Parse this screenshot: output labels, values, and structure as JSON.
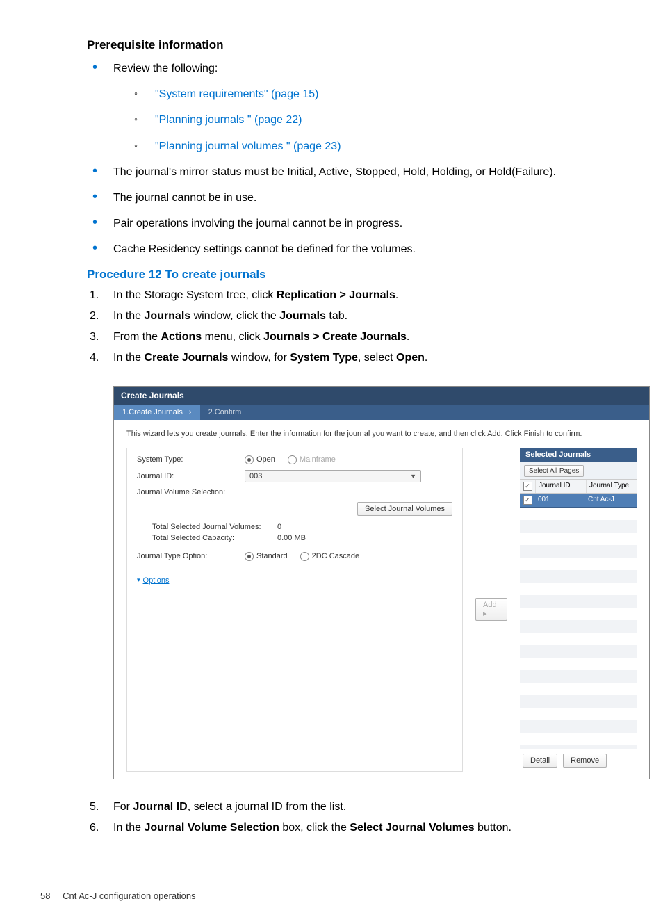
{
  "heading_prereq": "Prerequisite information",
  "bullets": {
    "review": "Review the following:",
    "sub1": "\"System requirements\" (page 15)",
    "sub2": "\"Planning journals \" (page 22)",
    "sub3": "\"Planning journal volumes \" (page 23)",
    "b2": "The journal's mirror status must be Initial, Active, Stopped, Hold, Holding, or Hold(Failure).",
    "b3": "The journal cannot be in use.",
    "b4": "Pair operations involving the journal cannot be in progress.",
    "b5": "Cache Residency settings cannot be defined for the volumes."
  },
  "proc_heading": "Procedure 12 To create journals",
  "steps": {
    "s1a": "In the Storage System tree, click ",
    "s1b": "Replication > Journals",
    "s1c": ".",
    "s2a": "In the ",
    "s2b": "Journals",
    "s2c": " window, click the ",
    "s2d": "Journals",
    "s2e": " tab.",
    "s3a": "From the ",
    "s3b": "Actions",
    "s3c": " menu, click ",
    "s3d": "Journals > Create Journals",
    "s3e": ".",
    "s4a": "In the ",
    "s4b": "Create Journals",
    "s4c": " window, for ",
    "s4d": "System Type",
    "s4e": ", select ",
    "s4f": "Open",
    "s4g": ".",
    "s5a": "For ",
    "s5b": "Journal ID",
    "s5c": ", select a journal ID from the list.",
    "s6a": "In the ",
    "s6b": "Journal Volume Selection",
    "s6c": " box, click the ",
    "s6d": "Select Journal Volumes",
    "s6e": " button."
  },
  "shot": {
    "title": "Create Journals",
    "tab1": "1.Create Journals",
    "tab2": "2.Confirm",
    "instr": "This wizard lets you create journals. Enter the information for the journal you want to create, and then click Add. Click Finish to confirm.",
    "system_type_label": "System Type:",
    "open": "Open",
    "mainframe": "Mainframe",
    "journal_id_label": "Journal ID:",
    "journal_id_value": "003",
    "jvs_label": "Journal Volume Selection:",
    "select_jv_btn": "Select Journal Volumes",
    "total_vols_label": "Total Selected Journal Volumes:",
    "total_vols_value": "0",
    "total_cap_label": "Total Selected Capacity:",
    "total_cap_value": "0.00 MB",
    "jto_label": "Journal Type Option:",
    "standard": "Standard",
    "cascade": "2DC Cascade",
    "options_link": "Options",
    "add_btn": "Add ▸",
    "sel_header": "Selected Journals",
    "select_all": "Select All Pages",
    "col_id": "Journal ID",
    "col_type": "Journal Type",
    "row_id": "001",
    "row_type": "Cnt Ac-J",
    "detail_btn": "Detail",
    "remove_btn": "Remove"
  },
  "footer": {
    "page": "58",
    "title": "Cnt Ac-J configuration operations"
  }
}
